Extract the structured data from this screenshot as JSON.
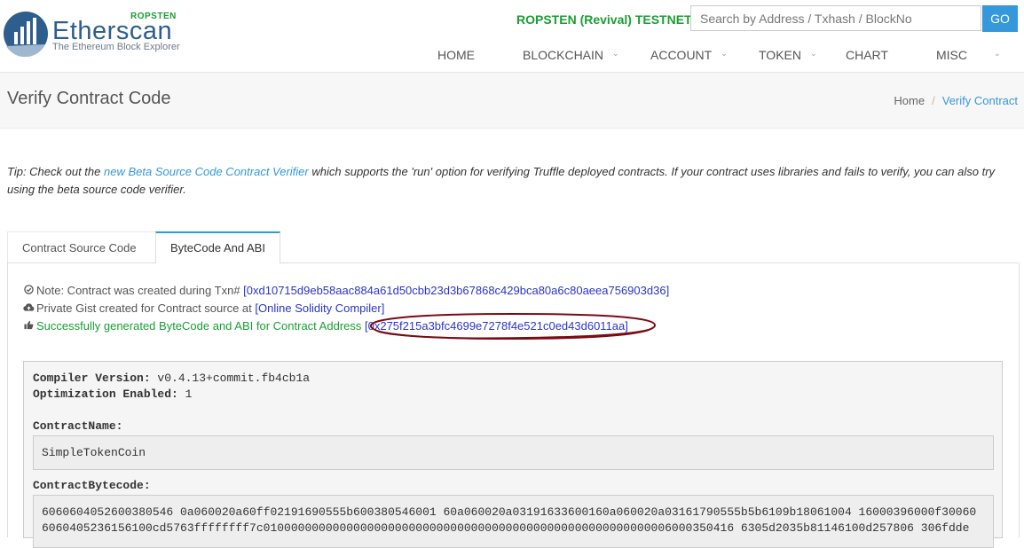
{
  "header": {
    "logo_name": "Etherscan",
    "logo_network": "ROPSTEN",
    "logo_tagline": "The Ethereum Block Explorer",
    "testnet_label": "ROPSTEN (Revival) TESTNET",
    "search_placeholder": "Search by Address / Txhash / BlockNo",
    "go_label": "GO"
  },
  "nav": {
    "home": "HOME",
    "blockchain": "BLOCKCHAIN",
    "account": "ACCOUNT",
    "token": "TOKEN",
    "chart": "CHART",
    "misc": "MISC"
  },
  "page": {
    "title": "Verify Contract Code",
    "breadcrumb_home": "Home",
    "breadcrumb_sep": "/",
    "breadcrumb_current": "Verify Contract"
  },
  "tip": {
    "prefix": "Tip: Check out the ",
    "link": "new Beta Source Code Contract Verifier",
    "suffix": " which supports the 'run' option for verifying Truffle deployed contracts. If your contract uses libraries and fails to verify, you can also try using the beta source code verifier."
  },
  "tabs": {
    "source": "Contract Source Code",
    "bytecode": "ByteCode And ABI"
  },
  "notes": {
    "txn_label": "Note: Contract was created during Txn# ",
    "txn_link": "[0xd10715d9eb58aac884a61d50cbb23d3b67868c429bca80a6c80aeea756903d36]",
    "gist_label": "Private Gist created for Contract source at ",
    "gist_link": "[Online Solidity Compiler]",
    "success_label": "Successfully generated ByteCode and ABI for Contract Address ",
    "success_link": "[0x275f215a3bfc4699e7278f4e521c0ed43d6011aa]"
  },
  "compiler": {
    "version_label": "Compiler Version:",
    "version_value": " v0.4.13+commit.fb4cb1a",
    "optimization_label": "Optimization Enabled:",
    "optimization_value": " 1",
    "contract_name_label": "ContractName:",
    "contract_name_value": "SimpleTokenCoin",
    "bytecode_label": "ContractBytecode:",
    "bytecode_line1": "6060604052600380546 0a060020a60ff02191690555b600380546001 60a060020a03191633600160a060020a03161790555b5b6109b18061004 16000396000f30060",
    "bytecode_line2": "6060405236156100cd5763ffffffff7c01000000000000000000000000000000000000000000000000000000006000350416 6305d2035b81146100d257806 306fdde"
  },
  "colors": {
    "accent": "#3498db",
    "green": "#1a9e33",
    "link_blue": "#2b35c8",
    "annotation_oval": "#7a0a14"
  },
  "icons": {
    "note": "check-circle-icon",
    "gist": "cloud-upload-icon",
    "success": "thumbs-up-icon"
  }
}
